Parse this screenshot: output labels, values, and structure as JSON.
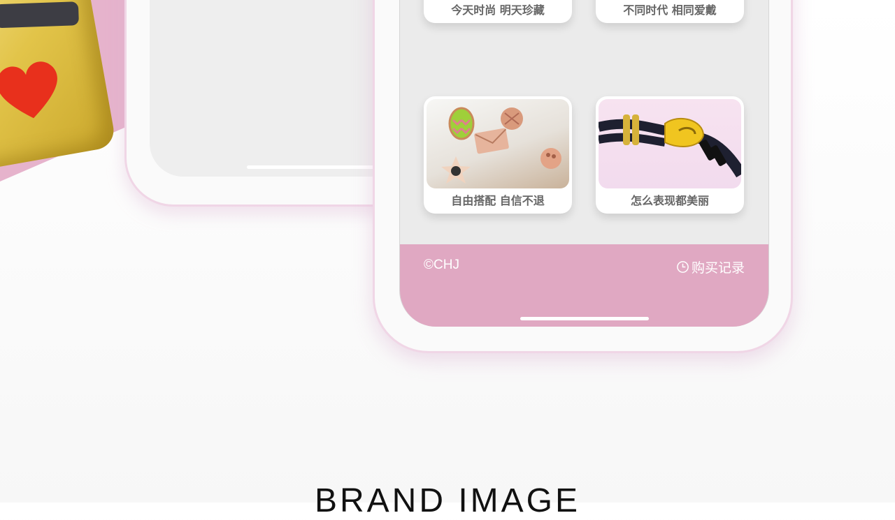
{
  "cards": [
    {
      "caption": "今天时尚 明天珍藏"
    },
    {
      "caption": "不同时代 相同爱戴"
    },
    {
      "caption": "自由搭配 自信不退"
    },
    {
      "caption": "怎么表现都美丽"
    }
  ],
  "footer": {
    "copyright": "©CHJ",
    "history_icon": "clock-icon",
    "history_label": "购买记录"
  },
  "brand_heading": "BRAND IMAGE",
  "colors": {
    "accent_pink": "#e0a8c2",
    "background_pink": "#e6b3cc",
    "caption_gray": "#666666"
  }
}
